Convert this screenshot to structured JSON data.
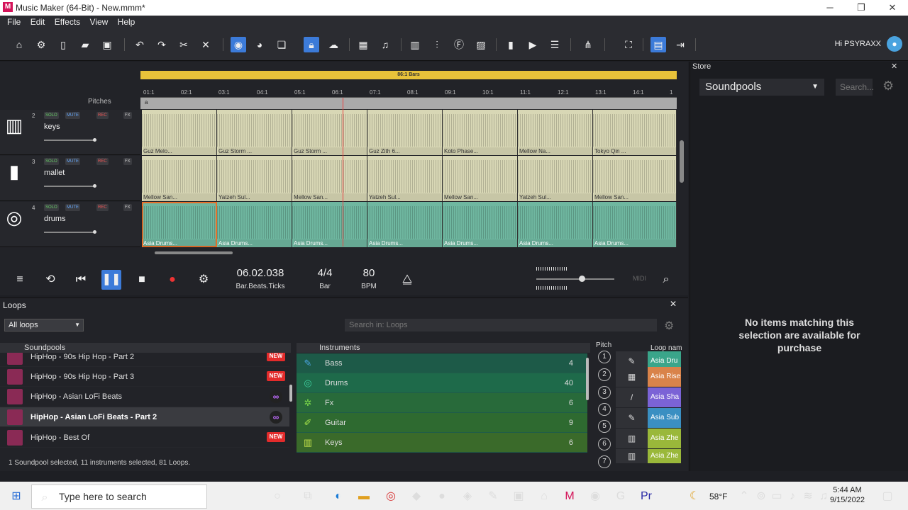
{
  "window": {
    "title": "Music Maker (64-Bit) - New.mmm*",
    "logo": "M",
    "min": "─",
    "max": "❐",
    "close": "✕"
  },
  "menu": [
    "File",
    "Edit",
    "Effects",
    "View",
    "Help"
  ],
  "toolbar": {
    "greeting": "Hi PSYRAXX"
  },
  "arranger": {
    "range_label": "86:1 Bars",
    "ruler": [
      "01:1",
      "02:1",
      "03:1",
      "04:1",
      "05:1",
      "06:1",
      "07:1",
      "08:1",
      "09:1",
      "10:1",
      "11:1",
      "12:1",
      "13:1",
      "14:1",
      "1"
    ],
    "pitches": "Pitches",
    "marker": "a",
    "tracks": [
      {
        "num": "2",
        "name": "keys",
        "icon": "piano-icon",
        "icon_char": "▥",
        "clips": [
          "Guz Melo...",
          "Guz Storm ...",
          "Guz Storm ...",
          "Guz Zith 6...",
          "Koto Phase...",
          "Mellow Na...",
          "Tokyo Qin ..."
        ]
      },
      {
        "num": "3",
        "name": "mallet",
        "icon": "mallet-icon",
        "icon_char": "▮",
        "clips": [
          "Mellow San...",
          "Yatzeh Sul...",
          "Mellow San...",
          "Yatzeh Sul...",
          "Mellow San...",
          "Yatzeh Sul...",
          "Mellow San..."
        ]
      },
      {
        "num": "4",
        "name": "drums",
        "icon": "drum-icon",
        "icon_char": "◎",
        "clips": [
          "Asia Drums...",
          "Asia Drums...",
          "Asia Drums...",
          "Asia Drums...",
          "Asia Drums...",
          "Asia Drums...",
          "Asia Drums..."
        ]
      }
    ],
    "track_buttons": {
      "solo": "SOLO",
      "mute": "MUTE",
      "rec": "REC",
      "fx": "FX"
    }
  },
  "transport": {
    "position": "06.02.038",
    "position_label": "Bar.Beats.Ticks",
    "signature": "4/4",
    "signature_label": "Bar",
    "tempo": "80",
    "tempo_label": "BPM",
    "midi": "MIDI"
  },
  "loops": {
    "title": "Loops",
    "filter": "All loops",
    "search_placeholder": "Search in: Loops",
    "soundpools_header": "Soundpools",
    "soundpools": [
      {
        "name": "HipHop - 90s Hip Hop - Part 2",
        "badge": "NEW"
      },
      {
        "name": "HipHop - 90s Hip Hop - Part 3",
        "badge": "NEW"
      },
      {
        "name": "HipHop - Asian LoFi Beats",
        "badge": "∞"
      },
      {
        "name": "HipHop - Asian LoFi Beats - Part 2",
        "badge": "∞"
      },
      {
        "name": "HipHop - Best Of",
        "badge": "NEW"
      }
    ],
    "instruments_header": "Instruments",
    "instruments": [
      {
        "name": "Bass",
        "count": "4",
        "icon": "bass-icon",
        "icon_char": "✎"
      },
      {
        "name": "Drums",
        "count": "40",
        "icon": "drums-icon",
        "icon_char": "◎"
      },
      {
        "name": "Fx",
        "count": "6",
        "icon": "fx-icon",
        "icon_char": "✲"
      },
      {
        "name": "Guitar",
        "count": "9",
        "icon": "guitar-icon",
        "icon_char": "✐"
      },
      {
        "name": "Keys",
        "count": "6",
        "icon": "keys-icon",
        "icon_char": "▥"
      }
    ],
    "pitch_header": "Pitch",
    "pitches": [
      "1",
      "2",
      "3",
      "4",
      "5",
      "6",
      "7"
    ],
    "loopname_header": "Loop nam",
    "loopnames": [
      {
        "name": "Asia Dru",
        "color": "#3aa58a",
        "icon_char": "✎"
      },
      {
        "name": "Asia Rise",
        "color": "#d9834a",
        "icon_char": "▦"
      },
      {
        "name": "Asia Sha",
        "color": "#7b63d6",
        "icon_char": "/"
      },
      {
        "name": "Asia Sub",
        "color": "#3a8fc2",
        "icon_char": "✎"
      },
      {
        "name": "Asia Zhe",
        "color": "#9ab83a",
        "icon_char": "▥"
      },
      {
        "name": "Asia Zhe",
        "color": "#9ab83a",
        "icon_char": "▥"
      }
    ],
    "status": "1 Soundpool selected, 11 instruments selected, 81 Loops."
  },
  "store": {
    "title": "Store",
    "selector": "Soundpools",
    "search_placeholder": "Search...",
    "message": "No items matching this selection are available for purchase"
  },
  "taskbar": {
    "search_placeholder": "Type here to search",
    "weather": "58°F",
    "time": "5:44 AM",
    "date": "9/15/2022"
  }
}
